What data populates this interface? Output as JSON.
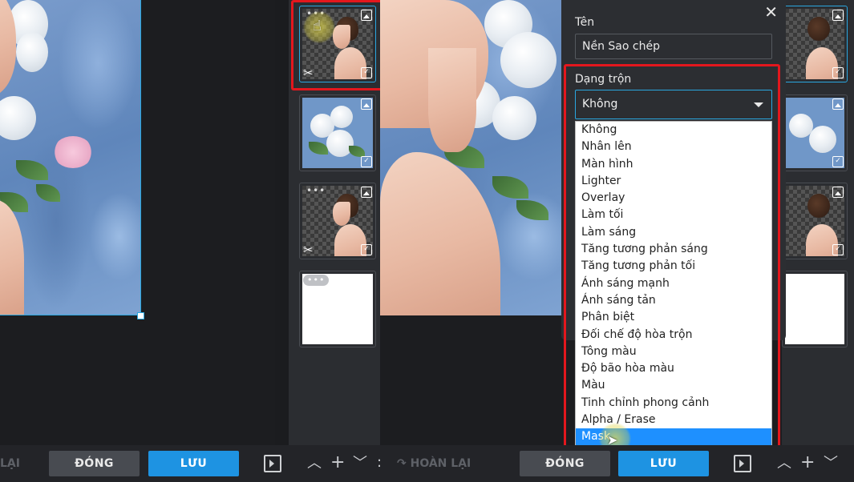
{
  "dialog": {
    "name_label": "Tên",
    "name_value": "Nền Sao chép",
    "blend_label": "Dạng trộn",
    "blend_selected": "Không",
    "blend_options": [
      "Không",
      "Nhân lên",
      "Màn hình",
      "Lighter",
      "Overlay",
      "Làm tối",
      "Làm sáng",
      "Tăng tương phản sáng",
      "Tăng tương phản tối",
      "Ánh sáng mạnh",
      "Ánh sáng tản",
      "Phân biệt",
      "Đối chế độ hòa trộn",
      "Tông màu",
      "Độ bão hòa màu",
      "Màu",
      "Tinh chỉnh phong cảnh",
      "Alpha / Erase",
      "Mask"
    ],
    "highlighted_option": "Mask",
    "close_glyph": "✕"
  },
  "toolbar_left": {
    "redo_partial": "LẠI",
    "close_label": "ĐÓNG",
    "save_label": "LƯU"
  },
  "toolbar_right": {
    "redo_label": "↷ HOÀN LẠI",
    "close_label": "ĐÓNG",
    "save_label": "LƯU"
  },
  "layer_controls": {
    "up": "︿",
    "add": "+",
    "down": "﹀",
    "more": ":"
  },
  "thumb_glyphs": {
    "dots": "•••",
    "scissors": "✂",
    "check": "✓"
  },
  "colors": {
    "accent": "#1e93e2",
    "highlight_red": "#e3171d",
    "panel_bg": "#2b2d31"
  }
}
